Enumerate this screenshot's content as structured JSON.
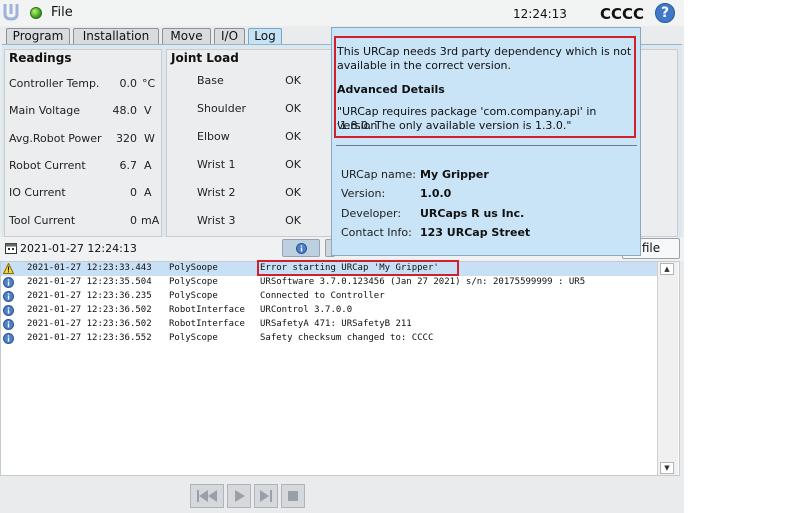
{
  "header": {
    "file_menu": "File",
    "clock": "12:24:13",
    "robot_name": "CCCC",
    "help": "?"
  },
  "tabs": [
    {
      "label": "Program"
    },
    {
      "label": "Installation"
    },
    {
      "label": "Move"
    },
    {
      "label": "I/O"
    },
    {
      "label": "Log",
      "active": true
    }
  ],
  "readings": {
    "title": "Readings",
    "rows": [
      {
        "label": "Controller Temp.",
        "value": "0.0",
        "unit": "°C"
      },
      {
        "label": "Main Voltage",
        "value": "48.0",
        "unit": "V"
      },
      {
        "label": "Avg.Robot Power",
        "value": "320",
        "unit": "W"
      },
      {
        "label": "Robot Current",
        "value": "6.7",
        "unit": "A"
      },
      {
        "label": "IO Current",
        "value": "0",
        "unit": "A"
      },
      {
        "label": "Tool Current",
        "value": "0",
        "unit": "mA"
      }
    ]
  },
  "joint_load": {
    "title": "Joint Load",
    "rows": [
      {
        "label": "Base",
        "value": "OK"
      },
      {
        "label": "Shoulder",
        "value": "OK"
      },
      {
        "label": "Elbow",
        "value": "OK"
      },
      {
        "label": "Wrist 1",
        "value": "OK"
      },
      {
        "label": "Wrist 2",
        "value": "OK"
      },
      {
        "label": "Wrist 3",
        "value": "OK"
      }
    ]
  },
  "log_toolbar": {
    "date": "2021-01-27 12:24:13",
    "save_button": "file"
  },
  "log_entries": [
    {
      "level": "warning",
      "timestamp": "2021-01-27 12:23:33.443",
      "source": "PolySoope",
      "message": "Error starting URCap 'My Gripper'",
      "selected": true
    },
    {
      "level": "info",
      "timestamp": "2021-01-27 12:23:35.504",
      "source": "PolyScope",
      "message": "URSoftware 3.7.0.123456 (Jan 27 2021) s/n: 20175599999 : UR5"
    },
    {
      "level": "info",
      "timestamp": "2021-01-27 12:23:36.235",
      "source": "PolyScope",
      "message": "Connected to Controller"
    },
    {
      "level": "info",
      "timestamp": "2021-01-27 12:23:36.502",
      "source": "RobotInterface",
      "message": "URControl 3.7.0.0"
    },
    {
      "level": "info",
      "timestamp": "2021-01-27 12:23:36.502",
      "source": "RobotInterface",
      "message": "URSafetyA 471: URSafetyB 211"
    },
    {
      "level": "info",
      "timestamp": "2021-01-27 12:23:36.552",
      "source": "PolyScope",
      "message": "Safety checksum changed to: CCCC"
    }
  ],
  "popup": {
    "summary_line1": "This URCap needs 3rd party dependency which is not",
    "summary_line2": "available in the correct version.",
    "advanced_heading": "Advanced Details",
    "detail_line1": "\"URCap requires package 'com.company.api' in version",
    "detail_line2": "'1.8.0. The only available version is 1.3.0.\"",
    "details": [
      {
        "label": "URCap name:",
        "value": "My Gripper"
      },
      {
        "label": "Version:",
        "value": "1.0.0"
      },
      {
        "label": "Developer:",
        "value": "URCaps R us Inc."
      },
      {
        "label": "Contact Info:",
        "value": "123 URCap Street"
      }
    ]
  },
  "colors": {
    "accent": "#c6e2f5",
    "popup_bg": "#c9e4f6",
    "highlight_border": "#d21f2a",
    "selected_row": "#c8e0f6",
    "status_ok": "#2e9a12"
  },
  "icons": {
    "logo": "ur-logo-icon",
    "status": "status-dot-icon",
    "help": "help-icon",
    "warning": "warning-icon",
    "info": "info-icon",
    "calendar": "calendar-icon"
  }
}
